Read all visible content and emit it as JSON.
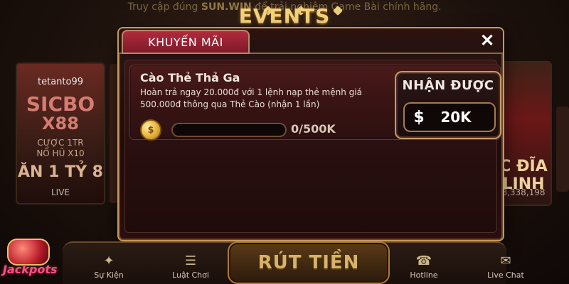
{
  "background": {
    "top_note_prefix": "Truy cập đúng",
    "top_note_brand": "SUN.WIN",
    "top_note_suffix": "để trải nghiệm Game Bài chính hãng.",
    "events_title": "EVENTS",
    "left_card": {
      "brand": "tetanto99",
      "game_big_1": "SICBO",
      "game_big_2": "X88",
      "promo_line_1": "CƯỢC 1TR",
      "promo_line_2": "NỔ HŨ X10",
      "headline": "ĂN 1 TỶ 8",
      "status": "LIVE"
    },
    "right_card": {
      "headline": "C ĐĨA LINH",
      "number": "8,338,198"
    },
    "jackpots_label": "Jackpots"
  },
  "modal": {
    "tab_title": "KHUYẾN MÃI",
    "close_symbol": "✕",
    "promo": {
      "name": "Cào Thẻ Thả Ga",
      "description": "Hoàn trả ngay 20.000đ với 1 lệnh nạp thẻ mệnh giá 500.000đ thông qua Thẻ Cào (nhận 1 lần)",
      "progress_text": "0/500K",
      "progress_fraction": 0,
      "coin_icon": "coin-icon"
    },
    "reward": {
      "title": "NHẬN ĐƯỢC",
      "currency_symbol": "$",
      "amount": "20K"
    }
  },
  "bottom_nav": {
    "items": [
      {
        "label": "Sự Kiện",
        "icon": "event-icon"
      },
      {
        "label": "Luật Chơi",
        "icon": "rules-icon"
      },
      {
        "label": "Hotline",
        "icon": "phone-icon"
      },
      {
        "label": "Live Chat",
        "icon": "chat-icon"
      }
    ],
    "center_button_label": "RÚT TIỀN"
  }
}
